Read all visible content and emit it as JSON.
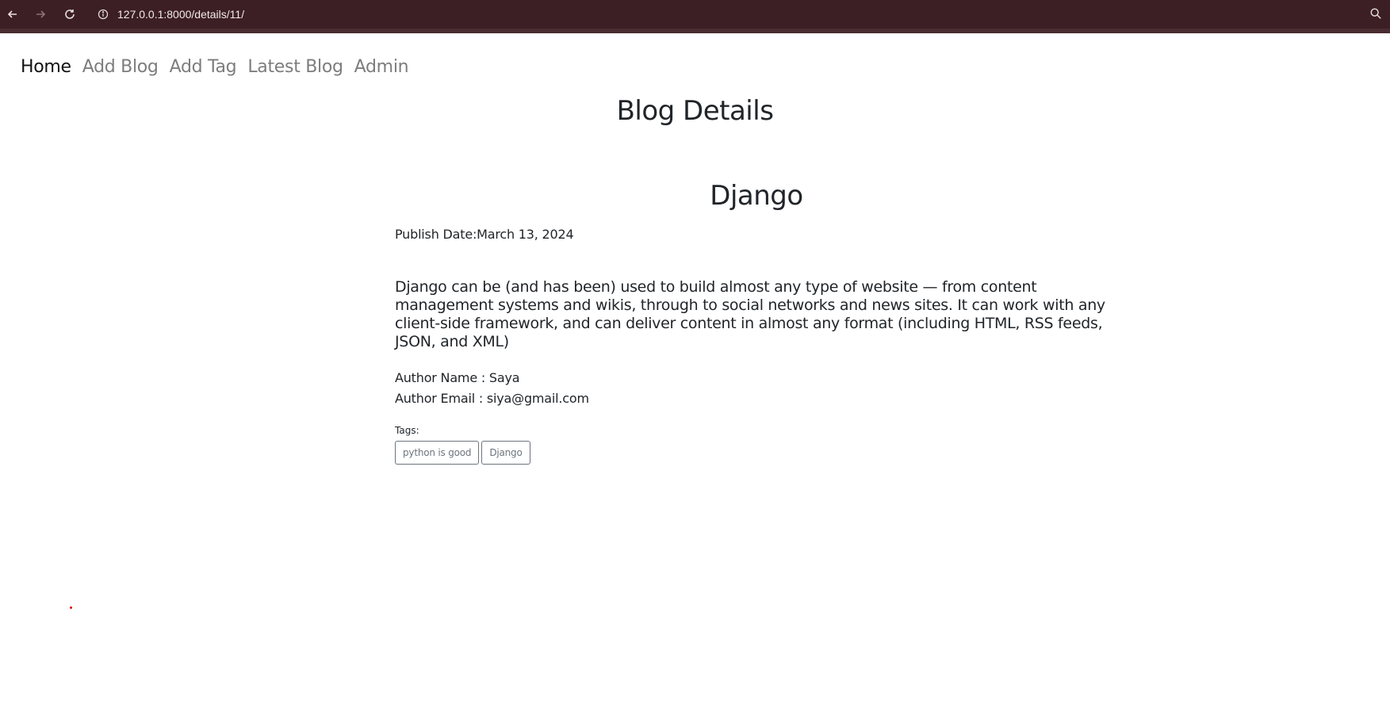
{
  "browser": {
    "url": "127.0.0.1:8000/details/11/"
  },
  "nav": {
    "items": [
      {
        "label": "Home"
      },
      {
        "label": "Add Blog"
      },
      {
        "label": "Add Tag"
      },
      {
        "label": "Latest Blog"
      },
      {
        "label": "Admin"
      }
    ]
  },
  "page": {
    "heading": "Blog Details"
  },
  "blog": {
    "title": "Django",
    "publish_date": "Publish Date:March 13, 2024",
    "description": "Django can be (and has been) used to build almost any type of website — from content management systems and wikis, through to social networks and news sites. It can work with any client-side framework, and can deliver content in almost any format (including HTML, RSS feeds, JSON, and XML)",
    "author_name": "Author Name : Saya",
    "author_email": "Author Email : siya@gmail.com",
    "tags_label": "Tags:",
    "tags": [
      "python is good",
      "Django"
    ]
  },
  "colors": {
    "browser_bar": "#3c1f24",
    "nav_inactive": "#7d7d7d",
    "nav_active": "#111111",
    "tag_border": "#6c757d"
  },
  "icons": {
    "back": "arrow-left-icon",
    "forward": "arrow-right-icon",
    "reload": "reload-icon",
    "site_info": "info-icon",
    "zoom": "zoom-icon"
  }
}
